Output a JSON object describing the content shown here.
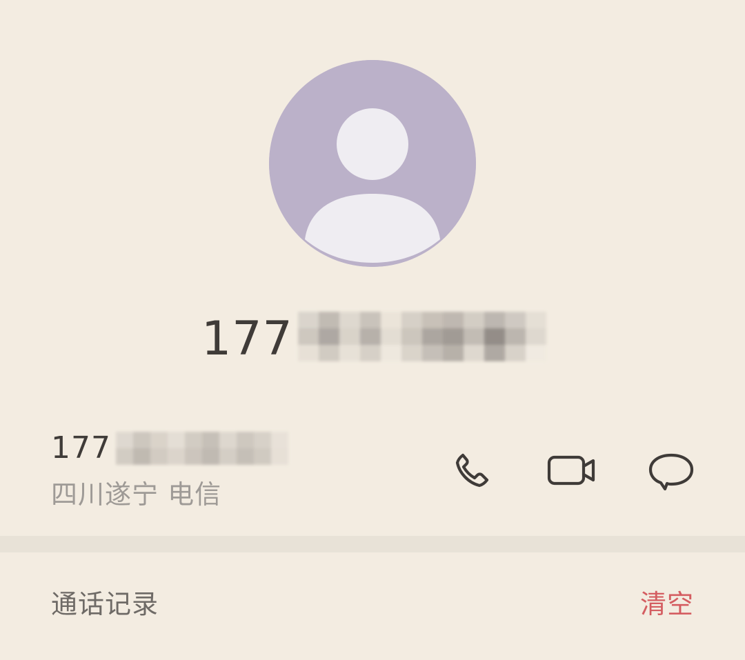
{
  "contact": {
    "display_number": "177",
    "number": "177",
    "location": "四川遂宁 电信"
  },
  "history": {
    "title": "通话记录",
    "clear_label": "清空"
  },
  "icons": {
    "avatar": "person-icon",
    "call": "phone-icon",
    "video": "video-call-icon",
    "message": "message-icon"
  },
  "colors": {
    "background": "#f3ece1",
    "avatar_bg": "#bbb1c9",
    "avatar_fg": "#efedf2",
    "text_primary": "#3f3b38",
    "text_secondary": "#9e9a96",
    "accent_red": "#d45d61"
  }
}
